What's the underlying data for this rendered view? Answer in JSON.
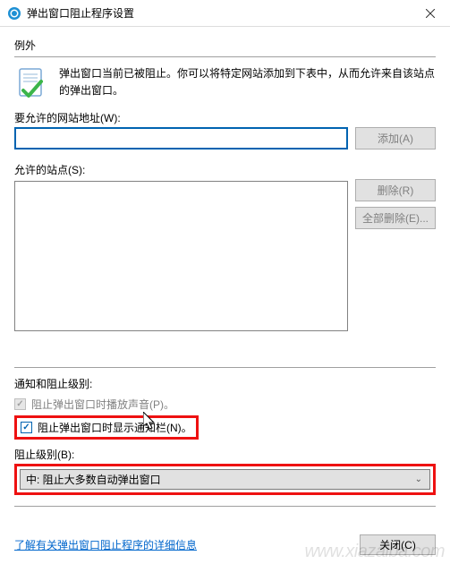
{
  "titlebar": {
    "title": "弹出窗口阻止程序设置"
  },
  "exceptions": {
    "header": "例外",
    "description": "弹出窗口当前已被阻止。你可以将特定网站添加到下表中，从而允许来自该站点的弹出窗口。",
    "address_label": "要允许的网站地址(W):",
    "address_value": "",
    "add_button": "添加(A)",
    "allowed_label": "允许的站点(S):",
    "remove_button": "删除(R)",
    "remove_all_button": "全部删除(E)..."
  },
  "notifications": {
    "header": "通知和阻止级别:",
    "play_sound_label": "阻止弹出窗口时播放声音(P)。",
    "play_sound_checked": true,
    "show_bar_label": "阻止弹出窗口时显示通知栏(N)。",
    "show_bar_checked": true,
    "level_label": "阻止级别(B):",
    "level_value": "中: 阻止大多数自动弹出窗口"
  },
  "footer": {
    "learn_more": "了解有关弹出窗口阻止程序的详细信息",
    "close_button": "关闭(C)"
  },
  "watermark": "www.xiazaiba.com"
}
